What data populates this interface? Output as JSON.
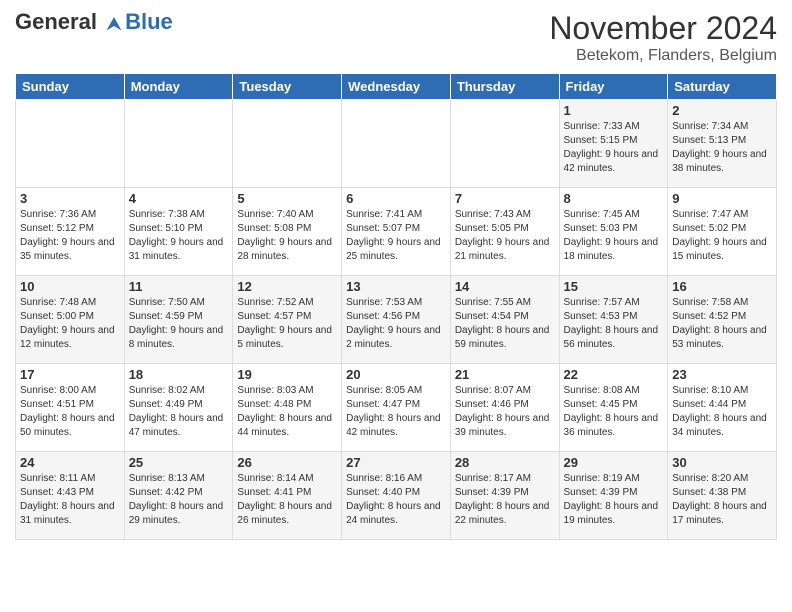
{
  "logo": {
    "text1": "General",
    "text2": "Blue"
  },
  "title": "November 2024",
  "subtitle": "Betekom, Flanders, Belgium",
  "days_of_week": [
    "Sunday",
    "Monday",
    "Tuesday",
    "Wednesday",
    "Thursday",
    "Friday",
    "Saturday"
  ],
  "weeks": [
    [
      {
        "day": "",
        "info": ""
      },
      {
        "day": "",
        "info": ""
      },
      {
        "day": "",
        "info": ""
      },
      {
        "day": "",
        "info": ""
      },
      {
        "day": "",
        "info": ""
      },
      {
        "day": "1",
        "info": "Sunrise: 7:33 AM\nSunset: 5:15 PM\nDaylight: 9 hours and 42 minutes."
      },
      {
        "day": "2",
        "info": "Sunrise: 7:34 AM\nSunset: 5:13 PM\nDaylight: 9 hours and 38 minutes."
      }
    ],
    [
      {
        "day": "3",
        "info": "Sunrise: 7:36 AM\nSunset: 5:12 PM\nDaylight: 9 hours and 35 minutes."
      },
      {
        "day": "4",
        "info": "Sunrise: 7:38 AM\nSunset: 5:10 PM\nDaylight: 9 hours and 31 minutes."
      },
      {
        "day": "5",
        "info": "Sunrise: 7:40 AM\nSunset: 5:08 PM\nDaylight: 9 hours and 28 minutes."
      },
      {
        "day": "6",
        "info": "Sunrise: 7:41 AM\nSunset: 5:07 PM\nDaylight: 9 hours and 25 minutes."
      },
      {
        "day": "7",
        "info": "Sunrise: 7:43 AM\nSunset: 5:05 PM\nDaylight: 9 hours and 21 minutes."
      },
      {
        "day": "8",
        "info": "Sunrise: 7:45 AM\nSunset: 5:03 PM\nDaylight: 9 hours and 18 minutes."
      },
      {
        "day": "9",
        "info": "Sunrise: 7:47 AM\nSunset: 5:02 PM\nDaylight: 9 hours and 15 minutes."
      }
    ],
    [
      {
        "day": "10",
        "info": "Sunrise: 7:48 AM\nSunset: 5:00 PM\nDaylight: 9 hours and 12 minutes."
      },
      {
        "day": "11",
        "info": "Sunrise: 7:50 AM\nSunset: 4:59 PM\nDaylight: 9 hours and 8 minutes."
      },
      {
        "day": "12",
        "info": "Sunrise: 7:52 AM\nSunset: 4:57 PM\nDaylight: 9 hours and 5 minutes."
      },
      {
        "day": "13",
        "info": "Sunrise: 7:53 AM\nSunset: 4:56 PM\nDaylight: 9 hours and 2 minutes."
      },
      {
        "day": "14",
        "info": "Sunrise: 7:55 AM\nSunset: 4:54 PM\nDaylight: 8 hours and 59 minutes."
      },
      {
        "day": "15",
        "info": "Sunrise: 7:57 AM\nSunset: 4:53 PM\nDaylight: 8 hours and 56 minutes."
      },
      {
        "day": "16",
        "info": "Sunrise: 7:58 AM\nSunset: 4:52 PM\nDaylight: 8 hours and 53 minutes."
      }
    ],
    [
      {
        "day": "17",
        "info": "Sunrise: 8:00 AM\nSunset: 4:51 PM\nDaylight: 8 hours and 50 minutes."
      },
      {
        "day": "18",
        "info": "Sunrise: 8:02 AM\nSunset: 4:49 PM\nDaylight: 8 hours and 47 minutes."
      },
      {
        "day": "19",
        "info": "Sunrise: 8:03 AM\nSunset: 4:48 PM\nDaylight: 8 hours and 44 minutes."
      },
      {
        "day": "20",
        "info": "Sunrise: 8:05 AM\nSunset: 4:47 PM\nDaylight: 8 hours and 42 minutes."
      },
      {
        "day": "21",
        "info": "Sunrise: 8:07 AM\nSunset: 4:46 PM\nDaylight: 8 hours and 39 minutes."
      },
      {
        "day": "22",
        "info": "Sunrise: 8:08 AM\nSunset: 4:45 PM\nDaylight: 8 hours and 36 minutes."
      },
      {
        "day": "23",
        "info": "Sunrise: 8:10 AM\nSunset: 4:44 PM\nDaylight: 8 hours and 34 minutes."
      }
    ],
    [
      {
        "day": "24",
        "info": "Sunrise: 8:11 AM\nSunset: 4:43 PM\nDaylight: 8 hours and 31 minutes."
      },
      {
        "day": "25",
        "info": "Sunrise: 8:13 AM\nSunset: 4:42 PM\nDaylight: 8 hours and 29 minutes."
      },
      {
        "day": "26",
        "info": "Sunrise: 8:14 AM\nSunset: 4:41 PM\nDaylight: 8 hours and 26 minutes."
      },
      {
        "day": "27",
        "info": "Sunrise: 8:16 AM\nSunset: 4:40 PM\nDaylight: 8 hours and 24 minutes."
      },
      {
        "day": "28",
        "info": "Sunrise: 8:17 AM\nSunset: 4:39 PM\nDaylight: 8 hours and 22 minutes."
      },
      {
        "day": "29",
        "info": "Sunrise: 8:19 AM\nSunset: 4:39 PM\nDaylight: 8 hours and 19 minutes."
      },
      {
        "day": "30",
        "info": "Sunrise: 8:20 AM\nSunset: 4:38 PM\nDaylight: 8 hours and 17 minutes."
      }
    ]
  ]
}
